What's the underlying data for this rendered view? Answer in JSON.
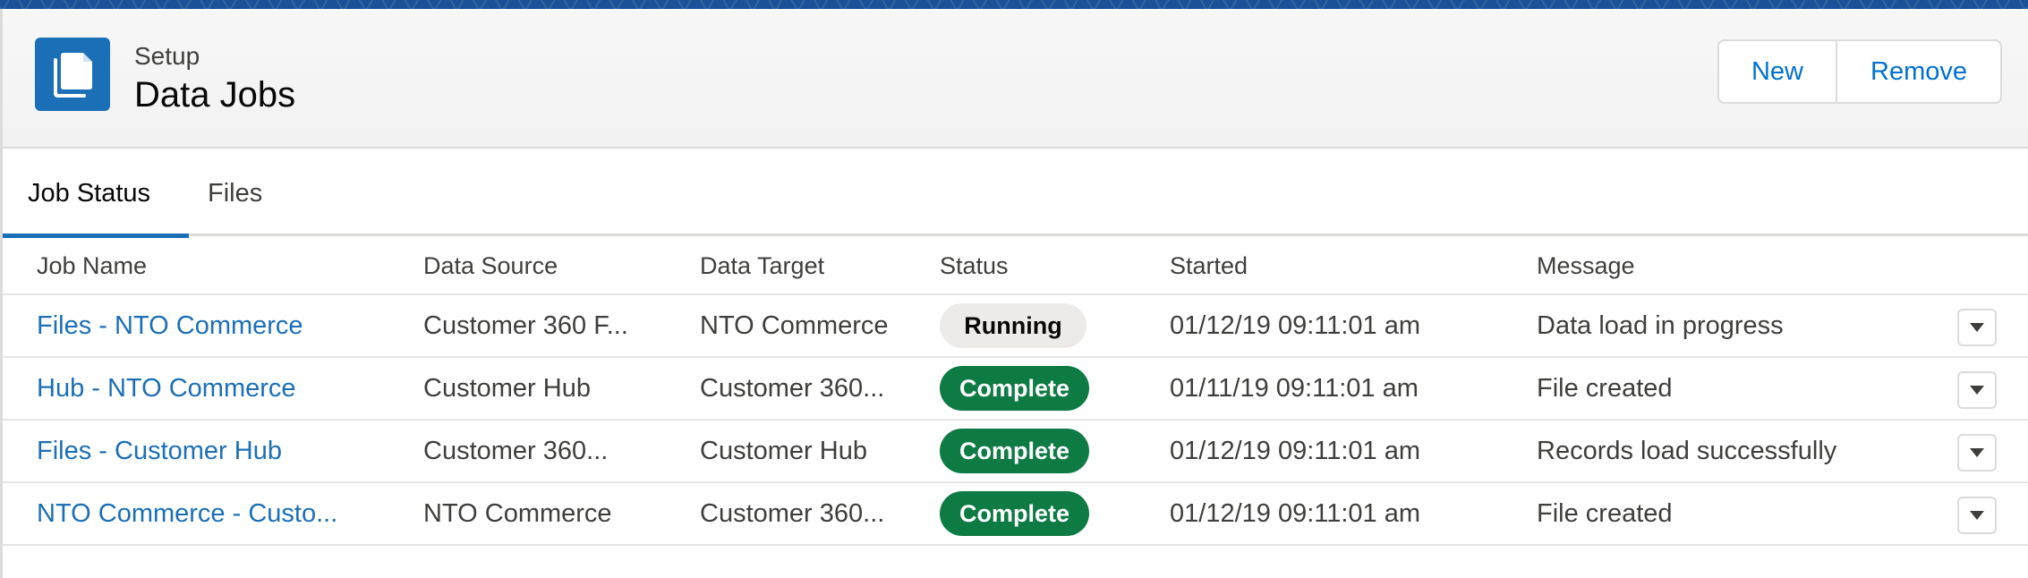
{
  "header": {
    "eyebrow": "Setup",
    "title": "Data Jobs",
    "icon": "documents-icon",
    "buttons": {
      "new_label": "New",
      "remove_label": "Remove"
    }
  },
  "tabs": [
    {
      "label": "Job Status",
      "active": true
    },
    {
      "label": "Files",
      "active": false
    }
  ],
  "table": {
    "columns": [
      "Job Name",
      "Data Source",
      "Data Target",
      "Status",
      "Started",
      "Message"
    ],
    "rows": [
      {
        "job_name": "Files - NTO Commerce",
        "data_source": "Customer 360 F...",
        "data_target": "NTO Commerce",
        "status": "Running",
        "started": "01/12/19 09:11:01 am",
        "message": "Data load in progress"
      },
      {
        "job_name": "Hub - NTO Commerce",
        "data_source": "Customer Hub",
        "data_target": "Customer 360...",
        "status": "Complete",
        "started": "01/11/19 09:11:01 am",
        "message": "File created"
      },
      {
        "job_name": "Files - Customer Hub",
        "data_source": "Customer 360...",
        "data_target": "Customer Hub",
        "status": "Complete",
        "started": "01/12/19 09:11:01 am",
        "message": "Records load successfully"
      },
      {
        "job_name": "NTO Commerce - Custo...",
        "data_source": "NTO Commerce",
        "data_target": "Customer 360...",
        "status": "Complete",
        "started": "01/12/19 09:11:01 am",
        "message": "File created"
      }
    ]
  },
  "colors": {
    "brand": "#1b6fb6",
    "link": "#1b6fb6",
    "complete": "#0e7a44",
    "running": "#ecebea",
    "header_strip": "#1b5297"
  }
}
